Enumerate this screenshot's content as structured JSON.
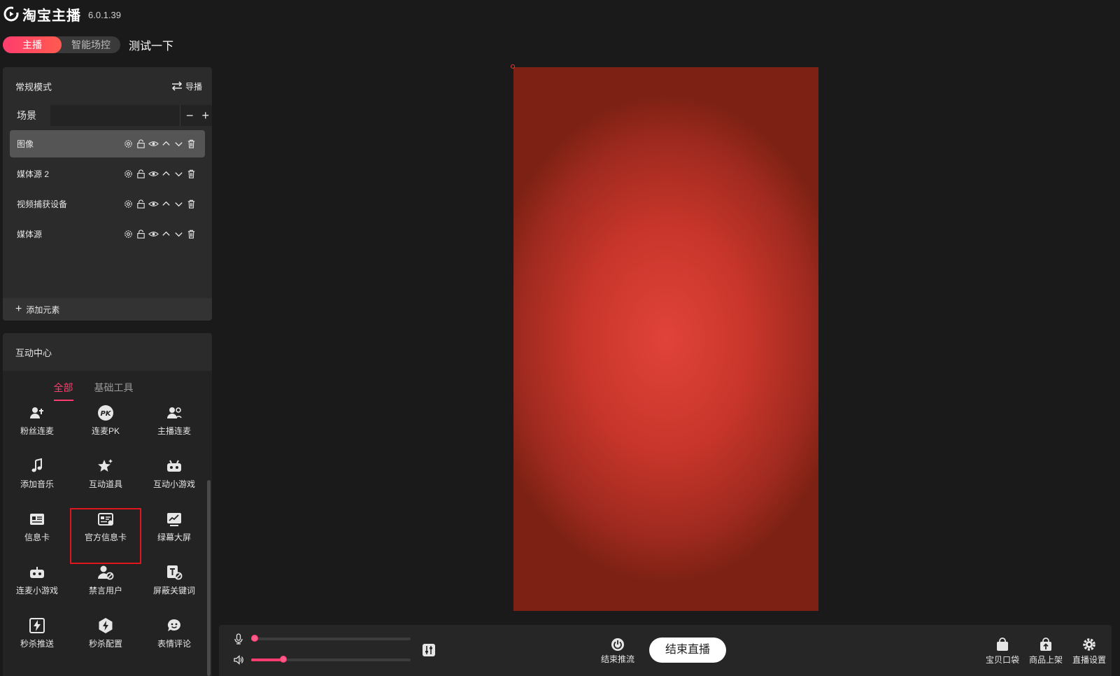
{
  "app": {
    "title": "淘宝主播",
    "version": "6.0.1.39"
  },
  "mode_toggle": {
    "active": "主播",
    "inactive": "智能场控"
  },
  "room_name": "测试一下",
  "scene_panel": {
    "mode_title": "常规模式",
    "switch_label": "导播",
    "scene_tab": "场景",
    "sources": [
      {
        "label": "图像",
        "selected": true
      },
      {
        "label": "媒体源 2",
        "selected": false
      },
      {
        "label": "视频捕获设备",
        "selected": false
      },
      {
        "label": "媒体源",
        "selected": false
      }
    ],
    "add_element": "添加元素"
  },
  "interaction": {
    "title": "互动中心",
    "tabs": [
      "全部",
      "基础工具"
    ],
    "tools": [
      {
        "label": "粉丝连麦",
        "icon": "user-connect-icon"
      },
      {
        "label": "连麦PK",
        "icon": "pk-icon"
      },
      {
        "label": "主播连麦",
        "icon": "anchor-connect-icon"
      },
      {
        "label": "添加音乐",
        "icon": "music-icon"
      },
      {
        "label": "互动道具",
        "icon": "interactive-props-icon"
      },
      {
        "label": "互动小游戏",
        "icon": "game-controller-icon"
      },
      {
        "label": "信息卡",
        "icon": "info-card-icon"
      },
      {
        "label": "官方信息卡",
        "icon": "official-info-card-icon"
      },
      {
        "label": "绿幕大屏",
        "icon": "green-screen-icon"
      },
      {
        "label": "连麦小游戏",
        "icon": "connect-game-icon"
      },
      {
        "label": "禁言用户",
        "icon": "mute-user-icon"
      },
      {
        "label": "屏蔽关键词",
        "icon": "block-keyword-icon"
      },
      {
        "label": "秒杀推送",
        "icon": "flash-sale-push-icon"
      },
      {
        "label": "秒杀配置",
        "icon": "flash-sale-config-icon"
      },
      {
        "label": "表情评论",
        "icon": "emoji-comment-icon"
      }
    ]
  },
  "bottom_bar": {
    "mic_level": 0.02,
    "volume_level": 0.2,
    "stop_push_label": "结束推流",
    "end_live_label": "结束直播",
    "right_tools": [
      "宝贝口袋",
      "商品上架",
      "直播设置"
    ]
  },
  "colors": {
    "accent": "#ff3d6e",
    "highlight_box": "#e0161f",
    "preview_red": "#d63a30"
  }
}
